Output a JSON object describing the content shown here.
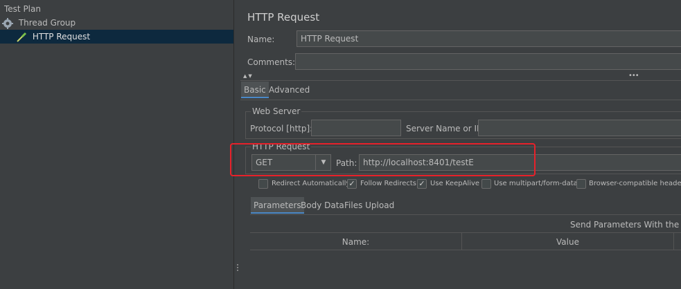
{
  "tree": {
    "items": [
      {
        "label": "Test Plan",
        "icon": "test-plan"
      },
      {
        "label": "Thread Group",
        "icon": "gear-icon"
      },
      {
        "label": "HTTP Request",
        "icon": "pipette-icon",
        "selected": true
      }
    ]
  },
  "panel": {
    "title": "HTTP Request",
    "name_label": "Name:",
    "name_value": "HTTP Request",
    "comments_label": "Comments:",
    "comments_value": "",
    "tabs": [
      {
        "label": "Basic",
        "active": true
      },
      {
        "label": "Advanced",
        "active": false
      }
    ]
  },
  "web_server": {
    "title": "Web Server",
    "protocol_label": "Protocol [http]:",
    "protocol_value": "",
    "server_label": "Server Name or IP:",
    "server_value": ""
  },
  "http_request": {
    "title": "HTTP Request",
    "method": "GET",
    "path_label": "Path:",
    "path_value": "http://localhost:8401/testE"
  },
  "options": [
    {
      "label": "Redirect Automatically",
      "checked": false
    },
    {
      "label": "Follow Redirects",
      "checked": true
    },
    {
      "label": "Use KeepAlive",
      "checked": true
    },
    {
      "label": "Use multipart/form-data",
      "checked": false
    },
    {
      "label": "Browser-compatible headers",
      "checked": false
    }
  ],
  "param_tabs": [
    {
      "label": "Parameters",
      "active": true
    },
    {
      "label": "Body Data",
      "active": false
    },
    {
      "label": "Files Upload",
      "active": false
    }
  ],
  "params": {
    "send_label": "Send Parameters With the Requ",
    "columns": [
      "Name:",
      "Value"
    ]
  },
  "colors": {
    "highlight": "#e8212a",
    "selection": "#0d293e",
    "background": "#3c3f41"
  }
}
